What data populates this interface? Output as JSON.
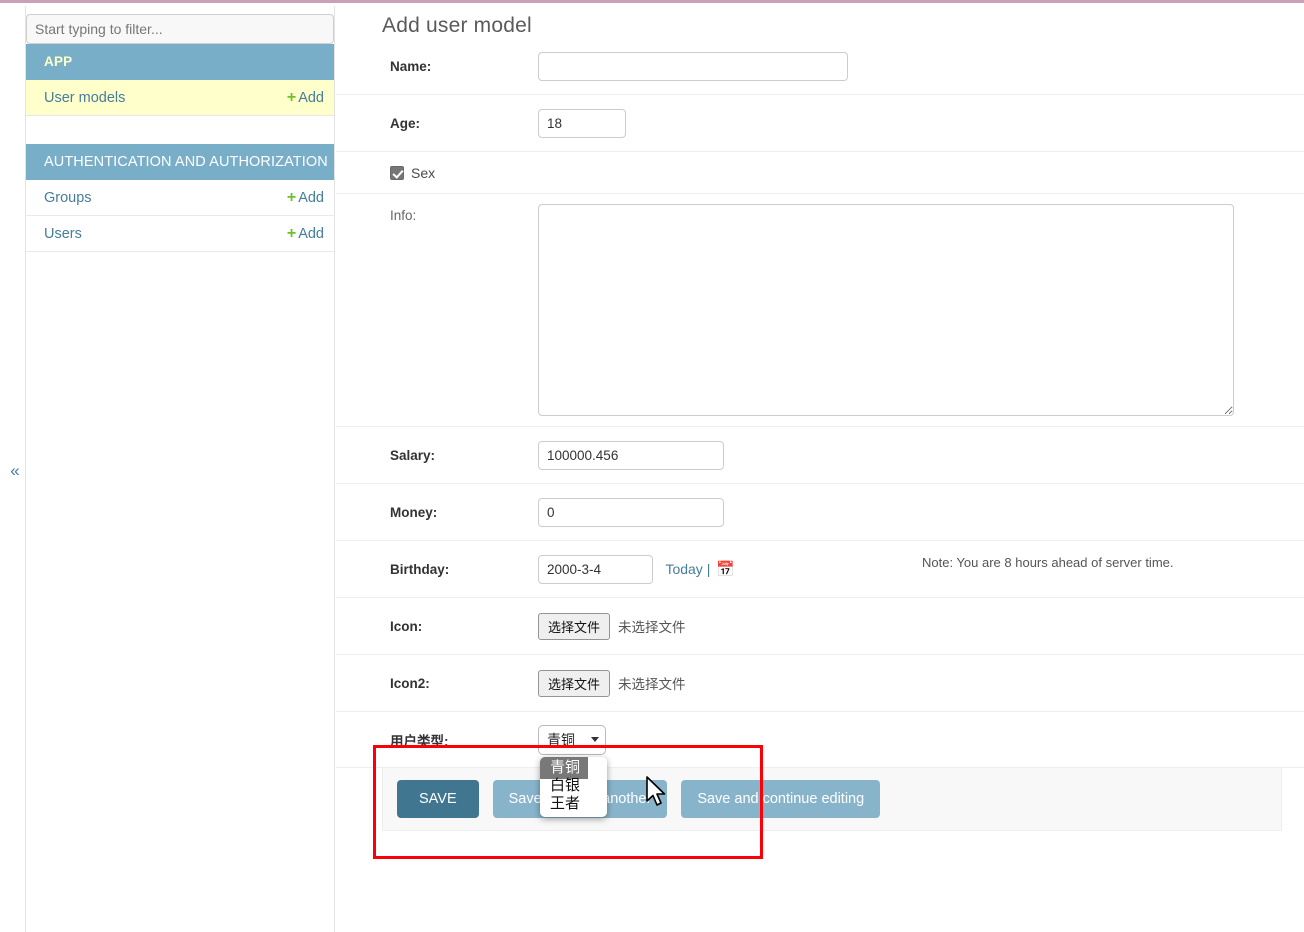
{
  "theme": {
    "top_border": "#c9a0b5",
    "accent_blue": "#79aec8",
    "link_blue": "#447e9b",
    "current_row": "#ffffcc",
    "plus_green": "#70bf2b",
    "highlight_red": "#fb0007",
    "save_dark": "#417690",
    "save_light": "#88b4cb"
  },
  "sidebar": {
    "filter_placeholder": "Start typing to filter...",
    "filter_value": "",
    "collapse_icon": "«",
    "groups": [
      {
        "title": "APP",
        "models": [
          {
            "label": "User models",
            "add_label": "Add",
            "plus": "+",
            "current": true
          }
        ]
      },
      {
        "title": "AUTHENTICATION AND AUTHORIZATION",
        "models": [
          {
            "label": "Groups",
            "add_label": "Add",
            "plus": "+",
            "current": false
          },
          {
            "label": "Users",
            "add_label": "Add",
            "plus": "+",
            "current": false
          }
        ]
      }
    ]
  },
  "main": {
    "page_title": "Add user model",
    "fields": {
      "name": {
        "label": "Name:",
        "value": ""
      },
      "age": {
        "label": "Age:",
        "value": "18"
      },
      "sex": {
        "label": "Sex",
        "checked": true
      },
      "info": {
        "label": "Info:",
        "value": ""
      },
      "salary": {
        "label": "Salary:",
        "value": "100000.456"
      },
      "money": {
        "label": "Money:",
        "value": "0"
      },
      "birthday": {
        "label": "Birthday:",
        "value": "2000-3-4",
        "today_link": "Today |",
        "calendar_icon": "📅",
        "timezone_note": "Note: You are 8 hours ahead of server time."
      },
      "icon": {
        "label": "Icon:",
        "button": "选择文件",
        "file_status": "未选择文件"
      },
      "icon2": {
        "label": "Icon2:",
        "button": "选择文件",
        "file_status": "未选择文件"
      },
      "user_type": {
        "label": "用户类型:",
        "selected": "青铜",
        "expanded": true,
        "options": [
          {
            "label": "青铜",
            "highlighted": true
          },
          {
            "label": "白银",
            "highlighted": false
          },
          {
            "label": "王者",
            "highlighted": false
          }
        ]
      }
    },
    "submit_row": {
      "save": "SAVE",
      "save_and_add_another": "Save and add another",
      "save_and_continue": "Save and continue editing"
    }
  }
}
